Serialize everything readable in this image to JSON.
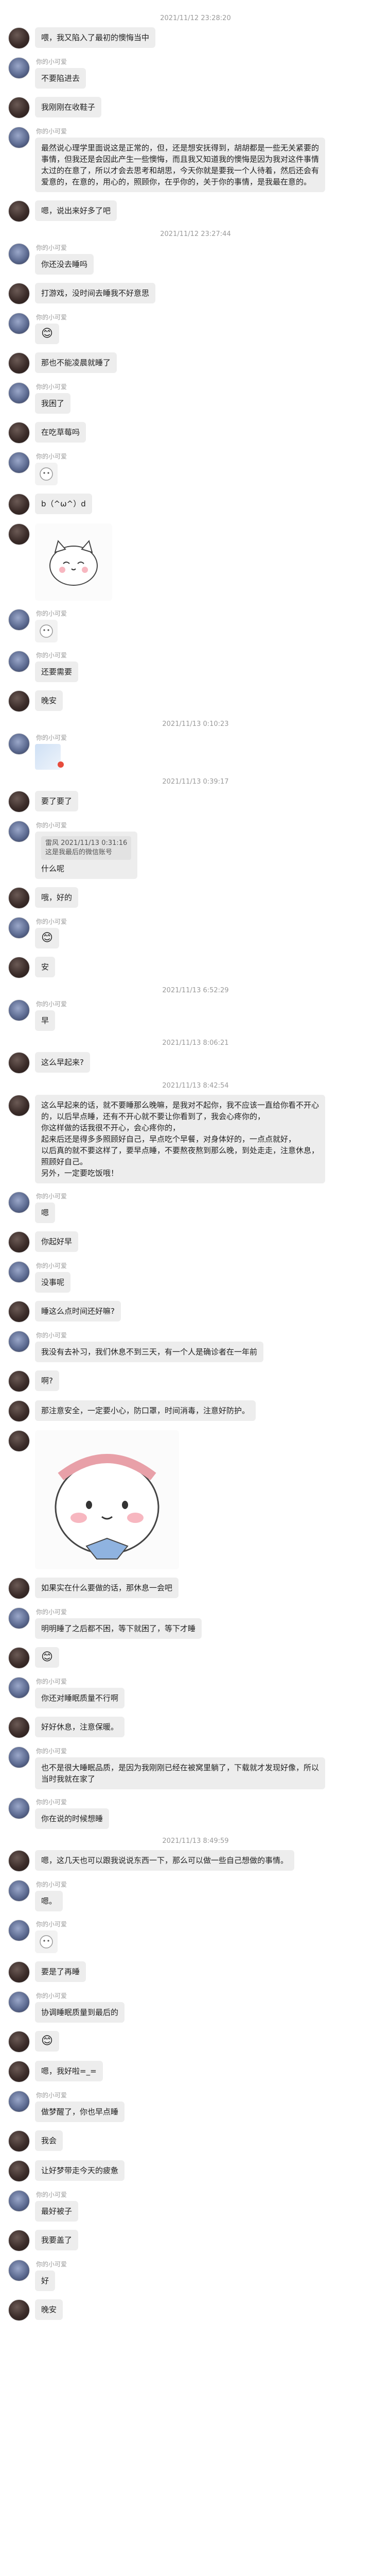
{
  "chat": {
    "items": [
      {
        "kind": "ts",
        "text": "2021/11/12 23:28:20"
      },
      {
        "kind": "msg",
        "who": "a",
        "sender": "",
        "text": "喂，我又陷入了最初的懊悔当中"
      },
      {
        "kind": "msg",
        "who": "b",
        "sender": "你的小可爱",
        "text": "不要陷进去"
      },
      {
        "kind": "msg",
        "who": "a",
        "sender": "",
        "text": "我刚刚在收鞋子"
      },
      {
        "kind": "msg",
        "who": "b",
        "sender": "你的小可爱",
        "long": true,
        "text": "最然说心理学里面说这是正常的，但，还是想安抚得到，胡胡都是一些无关紧要的事情，但我还是会因此产生一些懊悔，而且我又知道我的懊悔是因为我对这件事情太过的在意了，所以才会去思考和胡思，今天你就是要我一个人待着，然后还会有爱意的，在意的，用心的，照顾你，在乎你的，关于你的事情，是我最在意的。"
      },
      {
        "kind": "msg",
        "who": "a",
        "sender": "",
        "text": "嗯，说出来好多了吧"
      },
      {
        "kind": "ts",
        "text": "2021/11/12 23:27:44"
      },
      {
        "kind": "msg",
        "who": "b",
        "sender": "你的小可爱",
        "text": "你还没去睡吗"
      },
      {
        "kind": "msg",
        "who": "a",
        "sender": "",
        "text": "打游戏，没时间去睡我不好意思"
      },
      {
        "kind": "msg",
        "who": "b",
        "sender": "你的小可爱",
        "text": "😊",
        "emoji": true
      },
      {
        "kind": "msg",
        "who": "a",
        "sender": "",
        "text": "那也不能凌晨就睡了"
      },
      {
        "kind": "msg",
        "who": "b",
        "sender": "你的小可爱",
        "text": "我困了"
      },
      {
        "kind": "msg",
        "who": "a",
        "sender": "",
        "text": "在吃草莓吗"
      },
      {
        "kind": "msg",
        "who": "b",
        "sender": "你的小可爱",
        "sticker": "small",
        "text": ""
      },
      {
        "kind": "msg",
        "who": "a",
        "sender": "",
        "text": "b（^ω^）d"
      },
      {
        "kind": "msg",
        "who": "a",
        "sender": "",
        "sticker": "cat",
        "text": "晚安"
      },
      {
        "kind": "msg",
        "who": "b",
        "sender": "你的小可爱",
        "sticker": "small",
        "text": ""
      },
      {
        "kind": "msg",
        "who": "b",
        "sender": "你的小可爱",
        "text": "还要需要"
      },
      {
        "kind": "msg",
        "who": "a",
        "sender": "",
        "text": "晚安"
      },
      {
        "kind": "ts",
        "text": "2021/11/13 0:10:23"
      },
      {
        "kind": "msg",
        "who": "b",
        "sender": "你的小可爱",
        "image": true,
        "text": ""
      },
      {
        "kind": "ts",
        "text": "2021/11/13 0:39:17"
      },
      {
        "kind": "msg",
        "who": "a",
        "sender": "",
        "text": "要了要了"
      },
      {
        "kind": "msg",
        "who": "b",
        "sender": "你的小可爱",
        "quote": "雷风 2021/11/13 0:31:16\n这是我最后的微信账号",
        "text": "什么呢"
      },
      {
        "kind": "msg",
        "who": "a",
        "sender": "",
        "text": "哦，好的"
      },
      {
        "kind": "msg",
        "who": "b",
        "sender": "你的小可爱",
        "text": "😊",
        "emoji": true
      },
      {
        "kind": "msg",
        "who": "a",
        "sender": "",
        "text": "安"
      },
      {
        "kind": "ts",
        "text": "2021/11/13 6:52:29"
      },
      {
        "kind": "msg",
        "who": "b",
        "sender": "你的小可爱",
        "text": "早"
      },
      {
        "kind": "ts",
        "text": "2021/11/13 8:06:21"
      },
      {
        "kind": "msg",
        "who": "a",
        "sender": "",
        "text": "这么早起来?"
      },
      {
        "kind": "ts",
        "text": "2021/11/13 8:42:54"
      },
      {
        "kind": "msg",
        "who": "a",
        "sender": "",
        "long": true,
        "text": "这么早起来的话，就不要睡那么晚嘛，是我对不起你，我不应该一直给你看不开心的，以后早点睡，还有不开心就不要让你看到了，我会心疼你的，\n你这样做的话我很不开心，会心疼你的，\n起来后还是得多多照顾好自己，早点吃个早餐，对身体好的，一点点就好，\n以后真的就不要这样了，要早点睡，不要熬夜熬到那么晚，到处走走，注意休息，照顾好自己。\n另外，一定要吃饭哦！"
      },
      {
        "kind": "msg",
        "who": "b",
        "sender": "你的小可爱",
        "text": "嗯"
      },
      {
        "kind": "msg",
        "who": "a",
        "sender": "",
        "text": "你起好早"
      },
      {
        "kind": "msg",
        "who": "b",
        "sender": "你的小可爱",
        "text": "没事呢"
      },
      {
        "kind": "msg",
        "who": "a",
        "sender": "",
        "text": "睡这么点时间还好嘛?"
      },
      {
        "kind": "msg",
        "who": "b",
        "sender": "你的小可爱",
        "text": "我没有去补习，我们休息不到三天，有一个人是确诊者在一年前"
      },
      {
        "kind": "msg",
        "who": "a",
        "sender": "",
        "text": "啊?"
      },
      {
        "kind": "msg",
        "who": "a",
        "sender": "",
        "text": "那注意安全，一定要小心，防口罩，时间消毒，注意好防护。"
      },
      {
        "kind": "msg",
        "who": "a",
        "sender": "",
        "sticker": "bunny",
        "text": ""
      },
      {
        "kind": "msg",
        "who": "a",
        "sender": "",
        "text": "如果实在什么要做的话，那休息一会吧"
      },
      {
        "kind": "msg",
        "who": "b",
        "sender": "你的小可爱",
        "text": "明明睡了之后都不困，等下就困了，等下才睡"
      },
      {
        "kind": "msg",
        "who": "a",
        "sender": "",
        "text": "😊",
        "emoji": true
      },
      {
        "kind": "msg",
        "who": "b",
        "sender": "你的小可爱",
        "text": "你还对睡眠质量不行啊"
      },
      {
        "kind": "msg",
        "who": "a",
        "sender": "",
        "text": "好好休息，注意保暖。"
      },
      {
        "kind": "msg",
        "who": "b",
        "sender": "你的小可爱",
        "long": true,
        "text": "也不是很大睡眠品质，是因为我刚刚已经在被窝里躺了，下载就才发现好像，所以当时我就在家了"
      },
      {
        "kind": "msg",
        "who": "b",
        "sender": "你的小可爱",
        "text": "你在说的时候想睡"
      },
      {
        "kind": "ts",
        "text": "2021/11/13 8:49:59"
      },
      {
        "kind": "msg",
        "who": "a",
        "sender": "",
        "text": "嗯，这几天也可以跟我说说东西一下，那么可以做一些自己想做的事情。"
      },
      {
        "kind": "msg",
        "who": "b",
        "sender": "你的小可爱",
        "text": "嗯。"
      },
      {
        "kind": "msg",
        "who": "b",
        "sender": "你的小可爱",
        "sticker": "small",
        "text": ""
      },
      {
        "kind": "msg",
        "who": "a",
        "sender": "",
        "text": "要是了再睡"
      },
      {
        "kind": "msg",
        "who": "b",
        "sender": "你的小可爱",
        "text": "协调睡眠质量到最后的"
      },
      {
        "kind": "msg",
        "who": "a",
        "sender": "",
        "text": "😊",
        "emoji": true
      },
      {
        "kind": "msg",
        "who": "a",
        "sender": "",
        "text": "嗯，我好啦=_="
      },
      {
        "kind": "msg",
        "who": "b",
        "sender": "你的小可爱",
        "text": "做梦醒了，你也早点睡"
      },
      {
        "kind": "msg",
        "who": "a",
        "sender": "",
        "text": "我会"
      },
      {
        "kind": "msg",
        "who": "a",
        "sender": "",
        "text": "让好梦带走今天的疲惫"
      },
      {
        "kind": "msg",
        "who": "b",
        "sender": "你的小可爱",
        "text": "最好被子"
      },
      {
        "kind": "msg",
        "who": "a",
        "sender": "",
        "text": "我要盖了"
      },
      {
        "kind": "msg",
        "who": "b",
        "sender": "你的小可爱",
        "text": "好"
      },
      {
        "kind": "msg",
        "who": "a",
        "sender": "",
        "text": "晚安"
      }
    ]
  }
}
